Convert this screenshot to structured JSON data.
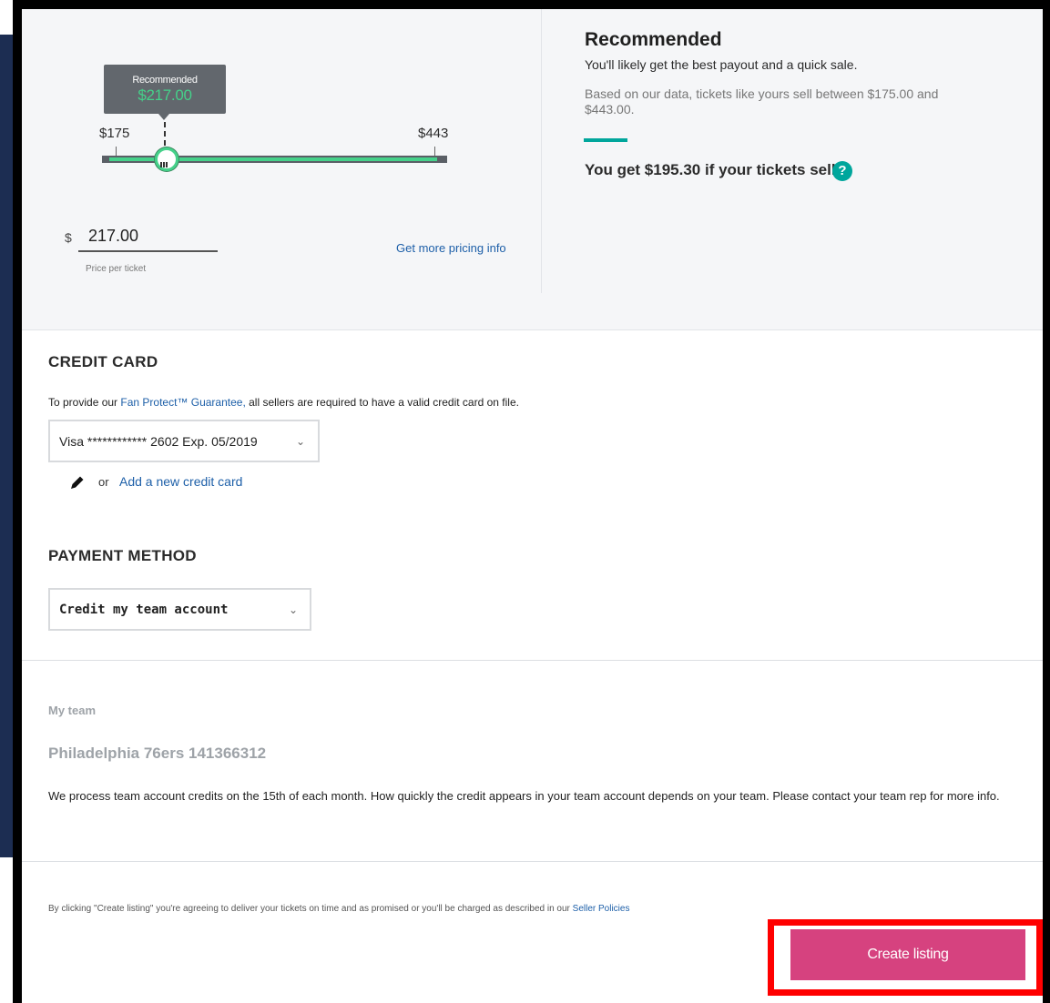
{
  "pricing": {
    "tooltip_label": "Recommended",
    "tooltip_price": "$217.00",
    "min_label": "$175",
    "max_label": "$443",
    "slider_min": 175,
    "slider_max": 443,
    "slider_value": 217,
    "currency_symbol": "$",
    "price_value": "217.00",
    "price_caption": "Price per ticket",
    "more_info_link": "Get more pricing info"
  },
  "recommendation": {
    "title": "Recommended",
    "subtitle": "You'll likely get the best payout and a quick sale.",
    "data_text": "Based on our data, tickets like yours sell between $175.00 and $443.00.",
    "payout_text": "You get $195.30 if your tickets sell",
    "help_icon": "?"
  },
  "credit_card": {
    "title": "CREDIT CARD",
    "desc_before": "To provide our ",
    "fan_protect_link": "Fan Protect™ Guarantee,",
    "desc_after": " all sellers are required to have a valid credit card on file.",
    "selected_card": "Visa ************ 2602 Exp. 05/2019",
    "or_text": "or",
    "add_card_link": "Add a new credit card"
  },
  "payment_method": {
    "title": "PAYMENT METHOD",
    "selected": "Credit my team account"
  },
  "team": {
    "label": "My team",
    "name": "Philadelphia 76ers 141366312",
    "info": "We process team account credits on the 15th of each month. How quickly the credit appears in your team account depends on your team. Please contact your team rep for more info."
  },
  "footer": {
    "terms_before": "By clicking \"Create listing\" you're agreeing to deliver your tickets on time and as promised or you'll be charged as described in our ",
    "terms_link": "Seller Policies",
    "create_button": "Create listing"
  },
  "colors": {
    "accent_green": "#45d18a",
    "teal": "#00a69c",
    "link_blue": "#1d5fa8",
    "button_pink": "#d6427f",
    "highlight_red": "#ff0000"
  },
  "icons": {
    "chevron": "chevron-down-icon",
    "pencil": "pencil-icon",
    "help": "help-circle-icon"
  }
}
